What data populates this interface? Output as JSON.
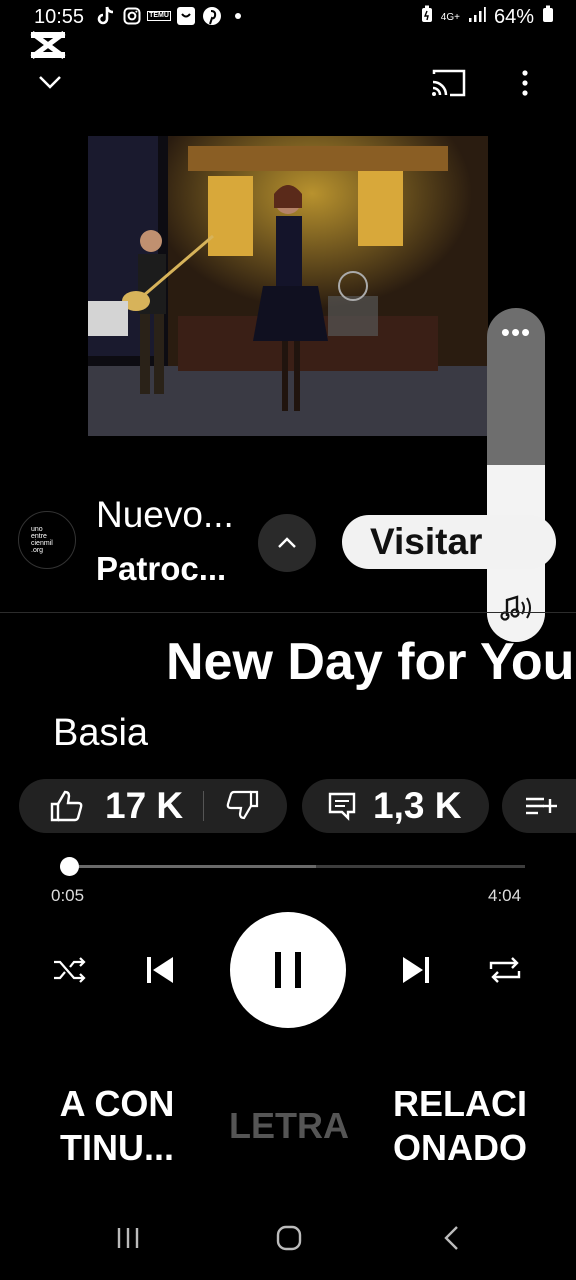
{
  "status": {
    "time": "10:55",
    "notification_icons": [
      "tiktok-icon",
      "instagram-icon",
      "temu-icon",
      "shop-icon",
      "pinterest-icon",
      "dot-icon"
    ],
    "temu_label": "TEMU",
    "network": "4G+",
    "battery": "64%"
  },
  "topbar": {
    "minimize_icon": "chevron-down-icon",
    "cast_icon": "cast-icon",
    "menu_icon": "more-vert-icon"
  },
  "volume": {
    "level": 0.53
  },
  "ad": {
    "logo_lines": [
      "uno",
      "entre",
      "cienmil",
      ".org"
    ],
    "title": "Nuevo...",
    "subtitle": "Patroc...",
    "cta": "Visitar"
  },
  "song": {
    "title": "New Day for You",
    "artist": "Basia"
  },
  "actions": {
    "likes": "17 K",
    "comments": "1,3 K"
  },
  "progress": {
    "current": "0:05",
    "total": "4:04",
    "fraction": 0.02,
    "buffered": 0.55
  },
  "tabs": {
    "up_next": "A CON TINU...",
    "lyrics": "LETRA",
    "related": "RELACI ONADO"
  },
  "colors": {
    "background": "#000000",
    "chip": "#222222",
    "inactive_tab": "#555555"
  }
}
